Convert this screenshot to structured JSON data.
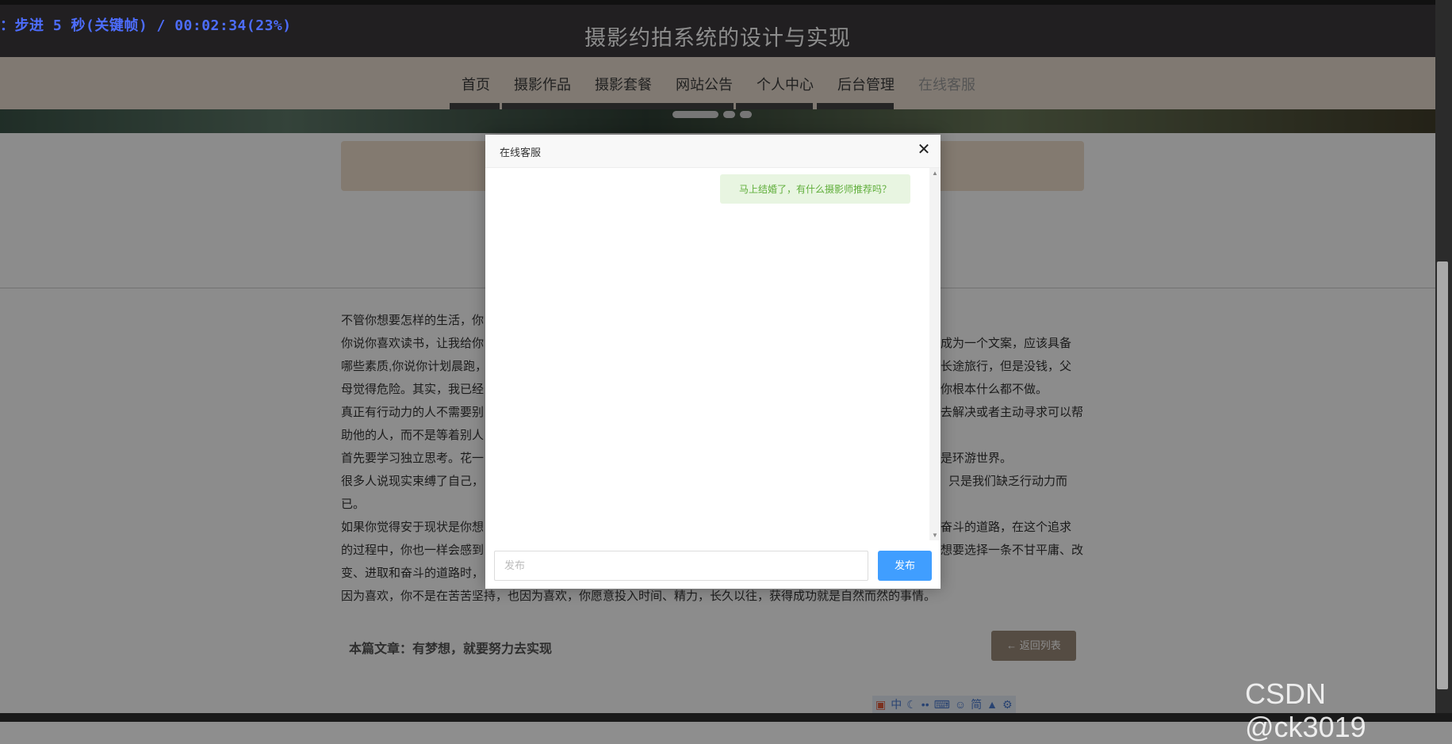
{
  "osd": {
    "text": "：步进 5 秒(关键帧) / 00:02:34(23%)"
  },
  "site": {
    "title": "摄影约拍系统的设计与实现"
  },
  "nav": {
    "items": [
      {
        "label": "首页",
        "active": false
      },
      {
        "label": "摄影作品",
        "active": false
      },
      {
        "label": "摄影套餐",
        "active": false
      },
      {
        "label": "网站公告",
        "active": false
      },
      {
        "label": "个人中心",
        "active": false
      },
      {
        "label": "后台管理",
        "active": false
      },
      {
        "label": "在线客服",
        "active": true
      }
    ]
  },
  "article": {
    "lines": [
      "不管你想要怎样的生活，你",
      "你说你喜欢读书，让我给你",
      "哪些素质,你说你计划晨跑，",
      "母觉得危险。其实，我已经",
      "真正有行动力的人不需要别",
      "助他的人，而不是等着别人",
      "首先要学习独立思考。花一",
      "很多人说现实束缚了自己，",
      "已。",
      "如果你觉得安于现状是你想",
      "的过程中，你也一样会感到",
      "变、进取和奋斗的道路时，",
      "因为喜欢，你不是在苦苦坚持，也因为喜欢，你愿意投入时间、精力，长久以往，获得成功就是自然而然的事情。"
    ],
    "right_fragments": [
      "成为一个文案，应该具备",
      "长途旅行，但是没钱，父",
      "你根本什么都不做。",
      "去解决或者主动寻求可以帮",
      "是环游世界。",
      "只是我们缺乏行动力而",
      "奋斗的道路，在这个追求",
      "想要选择一条不甘平庸、改"
    ],
    "current_label": "本篇文章：有梦想，就要努力去实现",
    "back_label": "返回列表"
  },
  "chat": {
    "title": "在线客服",
    "messages": [
      {
        "from": "me",
        "text": "马上结婚了，有什么摄影师推荐吗？"
      }
    ],
    "input_placeholder": "发布",
    "send_label": "发布"
  },
  "ime": {
    "items": [
      "中",
      "简"
    ]
  },
  "watermark": "CSDN @ck3019",
  "colors": {
    "topbar": "#3c3a3d",
    "nav_bg": "#e9ddcf",
    "send_button": "#409eff",
    "bubble_bg": "#e8f5e1",
    "bubble_text": "#5fae3a",
    "back_button": "#9c8b7b"
  }
}
